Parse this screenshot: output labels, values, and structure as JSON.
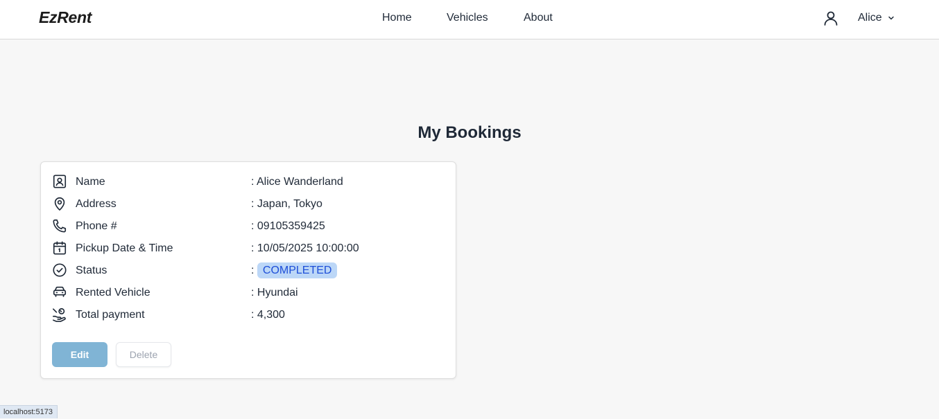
{
  "app": {
    "brand": "EzRent"
  },
  "nav": {
    "home": "Home",
    "vehicles": "Vehicles",
    "about": "About",
    "user_name": "Alice"
  },
  "page": {
    "title": "My Bookings"
  },
  "booking": {
    "rows": [
      {
        "icon": "contact-card-icon",
        "label": "Name",
        "value": ": Alice Wanderland"
      },
      {
        "icon": "map-pin-icon",
        "label": "Address",
        "value": ": Japan, Tokyo"
      },
      {
        "icon": "phone-icon",
        "label": "Phone #",
        "value": ": 09105359425"
      },
      {
        "icon": "calendar-icon",
        "label": "Pickup Date & Time",
        "value": ": 10/05/2025 10:00:00"
      },
      {
        "icon": "check-circle-icon",
        "label": "Status",
        "value_prefix": ": ",
        "value": "COMPLETED"
      },
      {
        "icon": "car-icon",
        "label": "Rented Vehicle",
        "value": ": Hyundai"
      },
      {
        "icon": "hand-coins-icon",
        "label": "Total payment",
        "value": ": 4,300"
      }
    ],
    "status_colors": {
      "badge_bg": "#bcd7f7",
      "badge_text": "#1d4ed8"
    },
    "edit_label": "Edit",
    "delete_label": "Delete"
  },
  "browser_status": {
    "url": "localhost:5173"
  },
  "colors": {
    "edit_button": "#80b4d5",
    "background": "#f7f7f7"
  }
}
